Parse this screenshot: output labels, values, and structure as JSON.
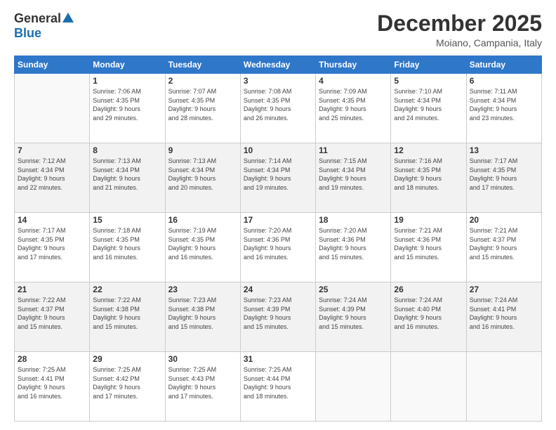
{
  "logo": {
    "general": "General",
    "blue": "Blue"
  },
  "header": {
    "month": "December 2025",
    "location": "Moiano, Campania, Italy"
  },
  "days_of_week": [
    "Sunday",
    "Monday",
    "Tuesday",
    "Wednesday",
    "Thursday",
    "Friday",
    "Saturday"
  ],
  "weeks": [
    [
      {
        "day": "",
        "info": ""
      },
      {
        "day": "1",
        "info": "Sunrise: 7:06 AM\nSunset: 4:35 PM\nDaylight: 9 hours\nand 29 minutes."
      },
      {
        "day": "2",
        "info": "Sunrise: 7:07 AM\nSunset: 4:35 PM\nDaylight: 9 hours\nand 28 minutes."
      },
      {
        "day": "3",
        "info": "Sunrise: 7:08 AM\nSunset: 4:35 PM\nDaylight: 9 hours\nand 26 minutes."
      },
      {
        "day": "4",
        "info": "Sunrise: 7:09 AM\nSunset: 4:35 PM\nDaylight: 9 hours\nand 25 minutes."
      },
      {
        "day": "5",
        "info": "Sunrise: 7:10 AM\nSunset: 4:34 PM\nDaylight: 9 hours\nand 24 minutes."
      },
      {
        "day": "6",
        "info": "Sunrise: 7:11 AM\nSunset: 4:34 PM\nDaylight: 9 hours\nand 23 minutes."
      }
    ],
    [
      {
        "day": "7",
        "info": "Sunrise: 7:12 AM\nSunset: 4:34 PM\nDaylight: 9 hours\nand 22 minutes."
      },
      {
        "day": "8",
        "info": "Sunrise: 7:13 AM\nSunset: 4:34 PM\nDaylight: 9 hours\nand 21 minutes."
      },
      {
        "day": "9",
        "info": "Sunrise: 7:13 AM\nSunset: 4:34 PM\nDaylight: 9 hours\nand 20 minutes."
      },
      {
        "day": "10",
        "info": "Sunrise: 7:14 AM\nSunset: 4:34 PM\nDaylight: 9 hours\nand 19 minutes."
      },
      {
        "day": "11",
        "info": "Sunrise: 7:15 AM\nSunset: 4:34 PM\nDaylight: 9 hours\nand 19 minutes."
      },
      {
        "day": "12",
        "info": "Sunrise: 7:16 AM\nSunset: 4:35 PM\nDaylight: 9 hours\nand 18 minutes."
      },
      {
        "day": "13",
        "info": "Sunrise: 7:17 AM\nSunset: 4:35 PM\nDaylight: 9 hours\nand 17 minutes."
      }
    ],
    [
      {
        "day": "14",
        "info": "Sunrise: 7:17 AM\nSunset: 4:35 PM\nDaylight: 9 hours\nand 17 minutes."
      },
      {
        "day": "15",
        "info": "Sunrise: 7:18 AM\nSunset: 4:35 PM\nDaylight: 9 hours\nand 16 minutes."
      },
      {
        "day": "16",
        "info": "Sunrise: 7:19 AM\nSunset: 4:35 PM\nDaylight: 9 hours\nand 16 minutes."
      },
      {
        "day": "17",
        "info": "Sunrise: 7:20 AM\nSunset: 4:36 PM\nDaylight: 9 hours\nand 16 minutes."
      },
      {
        "day": "18",
        "info": "Sunrise: 7:20 AM\nSunset: 4:36 PM\nDaylight: 9 hours\nand 15 minutes."
      },
      {
        "day": "19",
        "info": "Sunrise: 7:21 AM\nSunset: 4:36 PM\nDaylight: 9 hours\nand 15 minutes."
      },
      {
        "day": "20",
        "info": "Sunrise: 7:21 AM\nSunset: 4:37 PM\nDaylight: 9 hours\nand 15 minutes."
      }
    ],
    [
      {
        "day": "21",
        "info": "Sunrise: 7:22 AM\nSunset: 4:37 PM\nDaylight: 9 hours\nand 15 minutes."
      },
      {
        "day": "22",
        "info": "Sunrise: 7:22 AM\nSunset: 4:38 PM\nDaylight: 9 hours\nand 15 minutes."
      },
      {
        "day": "23",
        "info": "Sunrise: 7:23 AM\nSunset: 4:38 PM\nDaylight: 9 hours\nand 15 minutes."
      },
      {
        "day": "24",
        "info": "Sunrise: 7:23 AM\nSunset: 4:39 PM\nDaylight: 9 hours\nand 15 minutes."
      },
      {
        "day": "25",
        "info": "Sunrise: 7:24 AM\nSunset: 4:39 PM\nDaylight: 9 hours\nand 15 minutes."
      },
      {
        "day": "26",
        "info": "Sunrise: 7:24 AM\nSunset: 4:40 PM\nDaylight: 9 hours\nand 16 minutes."
      },
      {
        "day": "27",
        "info": "Sunrise: 7:24 AM\nSunset: 4:41 PM\nDaylight: 9 hours\nand 16 minutes."
      }
    ],
    [
      {
        "day": "28",
        "info": "Sunrise: 7:25 AM\nSunset: 4:41 PM\nDaylight: 9 hours\nand 16 minutes."
      },
      {
        "day": "29",
        "info": "Sunrise: 7:25 AM\nSunset: 4:42 PM\nDaylight: 9 hours\nand 17 minutes."
      },
      {
        "day": "30",
        "info": "Sunrise: 7:25 AM\nSunset: 4:43 PM\nDaylight: 9 hours\nand 17 minutes."
      },
      {
        "day": "31",
        "info": "Sunrise: 7:25 AM\nSunset: 4:44 PM\nDaylight: 9 hours\nand 18 minutes."
      },
      {
        "day": "",
        "info": ""
      },
      {
        "day": "",
        "info": ""
      },
      {
        "day": "",
        "info": ""
      }
    ]
  ]
}
